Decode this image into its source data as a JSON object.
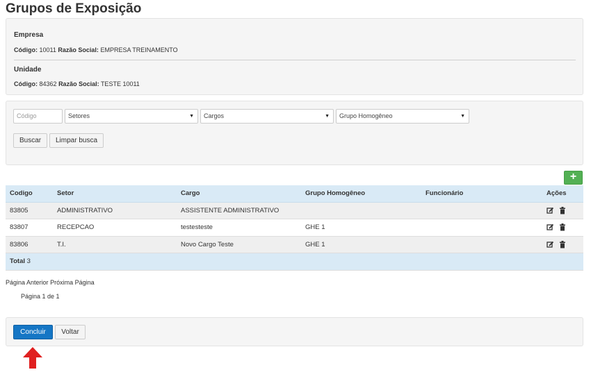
{
  "page": {
    "title": "Grupos de Exposição"
  },
  "empresa": {
    "heading": "Empresa",
    "code_label": "Código:",
    "code": "10011",
    "name_label": "Razão Social:",
    "name": "EMPRESA TREINAMENTO"
  },
  "unidade": {
    "heading": "Unidade",
    "code_label": "Código:",
    "code": "84362",
    "name_label": "Razão Social:",
    "name": "TESTE 10011"
  },
  "filters": {
    "code_placeholder": "Código",
    "setores": "Setores",
    "cargos": "Cargos",
    "grupo": "Grupo Homogêneo",
    "search_label": "Buscar",
    "clear_label": "Limpar busca"
  },
  "table": {
    "headers": {
      "codigo": "Codigo",
      "setor": "Setor",
      "cargo": "Cargo",
      "grupo": "Grupo Homogêneo",
      "funcionario": "Funcionário",
      "acoes": "Ações"
    },
    "rows": [
      {
        "codigo": "83805",
        "setor": "ADMINISTRATIVO",
        "cargo": "ASSISTENTE ADMINISTRATIVO",
        "grupo": ""
      },
      {
        "codigo": "83807",
        "setor": "RECEPCAO",
        "cargo": "testesteste",
        "grupo": "GHE 1"
      },
      {
        "codigo": "83806",
        "setor": "T.I.",
        "cargo": "Novo Cargo Teste",
        "grupo": "GHE 1"
      }
    ],
    "total_label": "Total",
    "total_value": "3"
  },
  "pagination": {
    "prev": "Página Anterior",
    "next": "Próxima Página",
    "status": "Página 1 de 1"
  },
  "footer": {
    "concluir": "Concluir",
    "voltar": "Voltar"
  },
  "colors": {
    "primary": "#1576c5",
    "add": "#53b054",
    "header": "#d9eaf6",
    "annotation_arrow": "#e02020"
  },
  "icons": [
    "plus-icon",
    "edit-icon",
    "trash-icon",
    "chevron-down-icon",
    "red-arrow-up-icon"
  ]
}
